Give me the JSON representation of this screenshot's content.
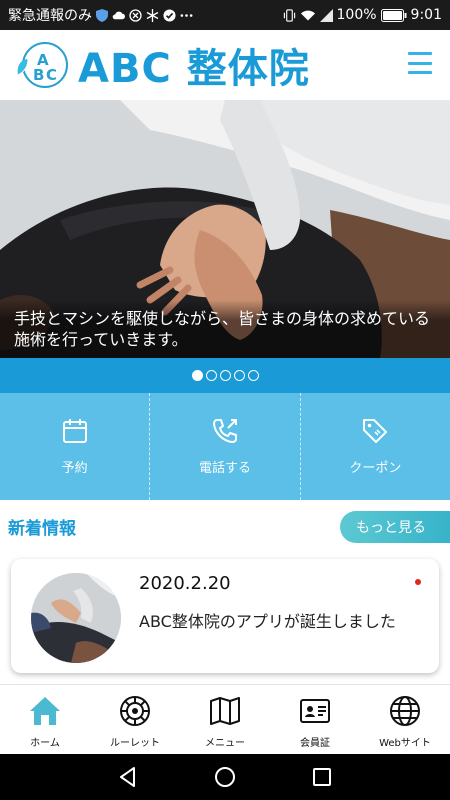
{
  "status_bar": {
    "carrier_text": "緊急通報のみ",
    "battery": "100%",
    "time": "9:01",
    "icons": [
      "shield-icon",
      "cloud-icon",
      "bluetooth-icon",
      "wrench-icon",
      "check-icon",
      "more-icon",
      "vibrate-icon",
      "wifi-icon",
      "signal-icon",
      "battery-icon"
    ]
  },
  "header": {
    "logo_letters": "ABC",
    "brand": "ABC 整体院",
    "menu_icon": "hamburger-menu-icon"
  },
  "hero": {
    "caption": "手技とマシンを駆使しながら、皆さまの身体の求めている施術を行っていきます。",
    "slide_count": 5,
    "active_slide": 1
  },
  "quick_actions": [
    {
      "label": "予約",
      "icon": "calendar-icon"
    },
    {
      "label": "電話する",
      "icon": "phone-icon"
    },
    {
      "label": "クーポン",
      "icon": "tag-icon"
    }
  ],
  "news": {
    "title": "新着情報",
    "more_label": "もっと見る",
    "items": [
      {
        "date": "2020.2.20",
        "text": "ABC整体院のアプリが誕生しました",
        "unread": true
      }
    ]
  },
  "tabs": [
    {
      "label": "ホーム",
      "icon": "home-icon",
      "active": true
    },
    {
      "label": "ルーレット",
      "icon": "roulette-icon",
      "active": false
    },
    {
      "label": "メニュー",
      "icon": "map-icon",
      "active": false
    },
    {
      "label": "会員証",
      "icon": "member-card-icon",
      "active": false
    },
    {
      "label": "Webサイト",
      "icon": "globe-icon",
      "active": false
    }
  ],
  "colors": {
    "brand_blue": "#1a9bd7",
    "quick_bg": "#5bbfe8",
    "teal": "#36b3c9",
    "home_icon": "#4cb9d2"
  }
}
